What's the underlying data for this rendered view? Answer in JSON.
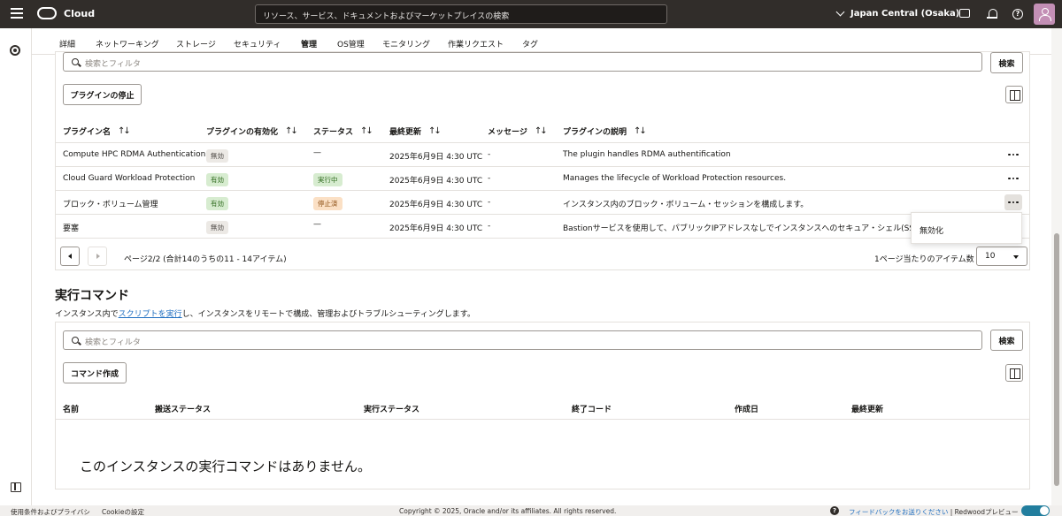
{
  "topbar": {
    "brand": "Cloud",
    "search_placeholder": "リソース、サービス、ドキュメントおよびマーケットプレイスの検索",
    "region": "Japan Central (Osaka)"
  },
  "tabs": [
    "詳細",
    "ネットワーキング",
    "ストレージ",
    "セキュリティ",
    "管理",
    "OS管理",
    "モニタリング",
    "作業リクエスト",
    "タグ"
  ],
  "active_tab": "管理",
  "plugins": {
    "filter_placeholder": "検索とフィルタ",
    "search_button": "検索",
    "stop_button": "プラグインの停止",
    "columns": [
      "プラグイン名",
      "プラグインの有効化",
      "ステータス",
      "最終更新",
      "メッセージ",
      "プラグインの説明"
    ],
    "rows": [
      {
        "name": "Compute HPC RDMA Authentication",
        "enabled": "無効",
        "status": "—",
        "updated": "2025年6月9日 4:30 UTC",
        "message": "-",
        "description": "The plugin handles RDMA authentification"
      },
      {
        "name": "Cloud Guard Workload Protection",
        "enabled": "有効",
        "status": "実行中",
        "updated": "2025年6月9日 4:30 UTC",
        "message": "-",
        "description": "Manages the lifecycle of Workload Protection resources."
      },
      {
        "name": "ブロック・ボリューム管理",
        "enabled": "有効",
        "status": "停止済",
        "updated": "2025年6月9日 4:30 UTC",
        "message": "-",
        "description": "インスタンス内のブロック・ボリューム・セッションを構成します。"
      },
      {
        "name": "要塞",
        "enabled": "無効",
        "status": "—",
        "updated": "2025年6月9日 4:30 UTC",
        "message": "-",
        "description": "Bastionサービスを使用して、パブリックIPアドレスなしでインスタンスへのセキュア・シェル(SSH)接"
      }
    ],
    "menu_item": "無効化",
    "pagination_text": "ページ2/2 (合計14のうちの11 - 14アイテム)",
    "per_page_label": "1ページ当たりのアイテム数",
    "per_page_value": "10"
  },
  "run_commands": {
    "title": "実行コマンド",
    "desc_before": "インスタンス内で",
    "desc_link": "スクリプトを実行",
    "desc_after": "し、インスタンスをリモートで構成、管理およびトラブルシューティングします。",
    "filter_placeholder": "検索とフィルタ",
    "search_button": "検索",
    "create_button": "コマンド作成",
    "columns": [
      "名前",
      "搬送ステータス",
      "実行ステータス",
      "終了コード",
      "作成日",
      "最終更新"
    ],
    "empty_message": "このインスタンスの実行コマンドはありません。"
  },
  "footer": {
    "terms": "使用条件およびプライバシ",
    "cookies": "Cookieの設定",
    "copyright": "Copyright © 2025, Oracle and/or its affiliates. All rights reserved.",
    "feedback": "フィードバックをお送りください",
    "separator": "|",
    "preview": "Redwoodプレビュー"
  }
}
